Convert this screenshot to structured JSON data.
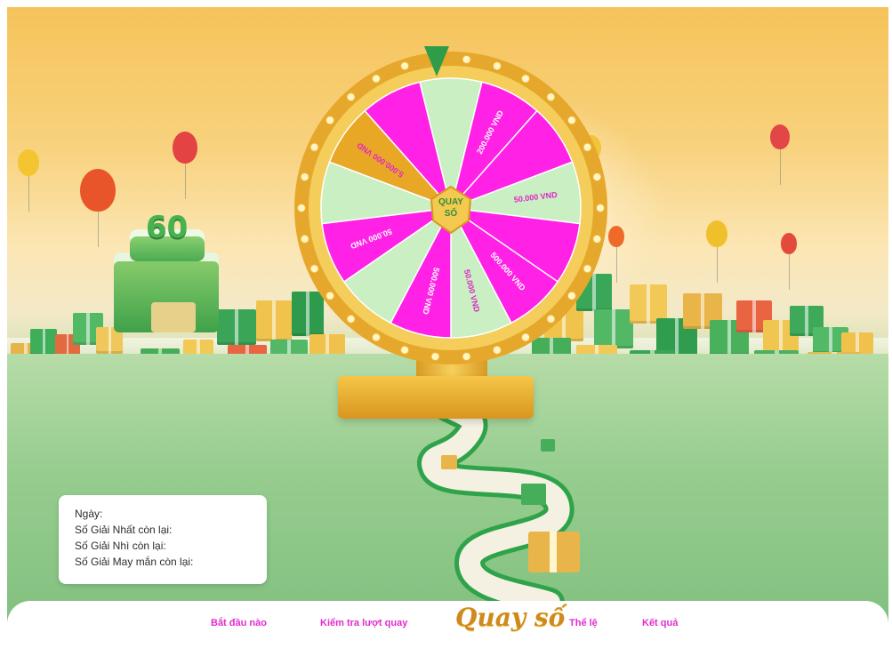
{
  "colors": {
    "magenta": "#ff22e6",
    "mint": "#c9efc3",
    "gold": "#e9a726",
    "wheel_green": "#55c15b",
    "nav_text": "#e12ad0"
  },
  "wheel": {
    "center_line1": "QUAY",
    "center_line2": "SỐ",
    "segments": [
      {
        "color": "magenta",
        "text": ""
      },
      {
        "color": "mint",
        "text": ""
      },
      {
        "color": "magenta",
        "text": "200.000 VND"
      },
      {
        "color": "magenta",
        "text": ""
      },
      {
        "color": "mint",
        "text": "50.000 VND"
      },
      {
        "color": "magenta",
        "text": ""
      },
      {
        "color": "magenta",
        "text": "500.000 VND"
      },
      {
        "color": "mint",
        "text": "50.000 VND"
      },
      {
        "color": "magenta",
        "text": "500.000 VND"
      },
      {
        "color": "mint",
        "text": ""
      },
      {
        "color": "magenta",
        "text": "50.000 VND"
      },
      {
        "color": "mint",
        "text": ""
      },
      {
        "color": "gold",
        "text": "5.000.000 VND"
      }
    ]
  },
  "cake_label": "60",
  "info": {
    "line1": "Ngày:",
    "line2": "Số Giải Nhất còn lại:",
    "line3": "Số Giải Nhì còn lại:",
    "line4": "Số Giải May mắn còn lại:"
  },
  "nav": {
    "start": "Bắt đầu nào",
    "check": "Kiểm tra lượt quay",
    "title": "Quay số",
    "rules": "Thể lệ",
    "results": "Kết quả"
  }
}
